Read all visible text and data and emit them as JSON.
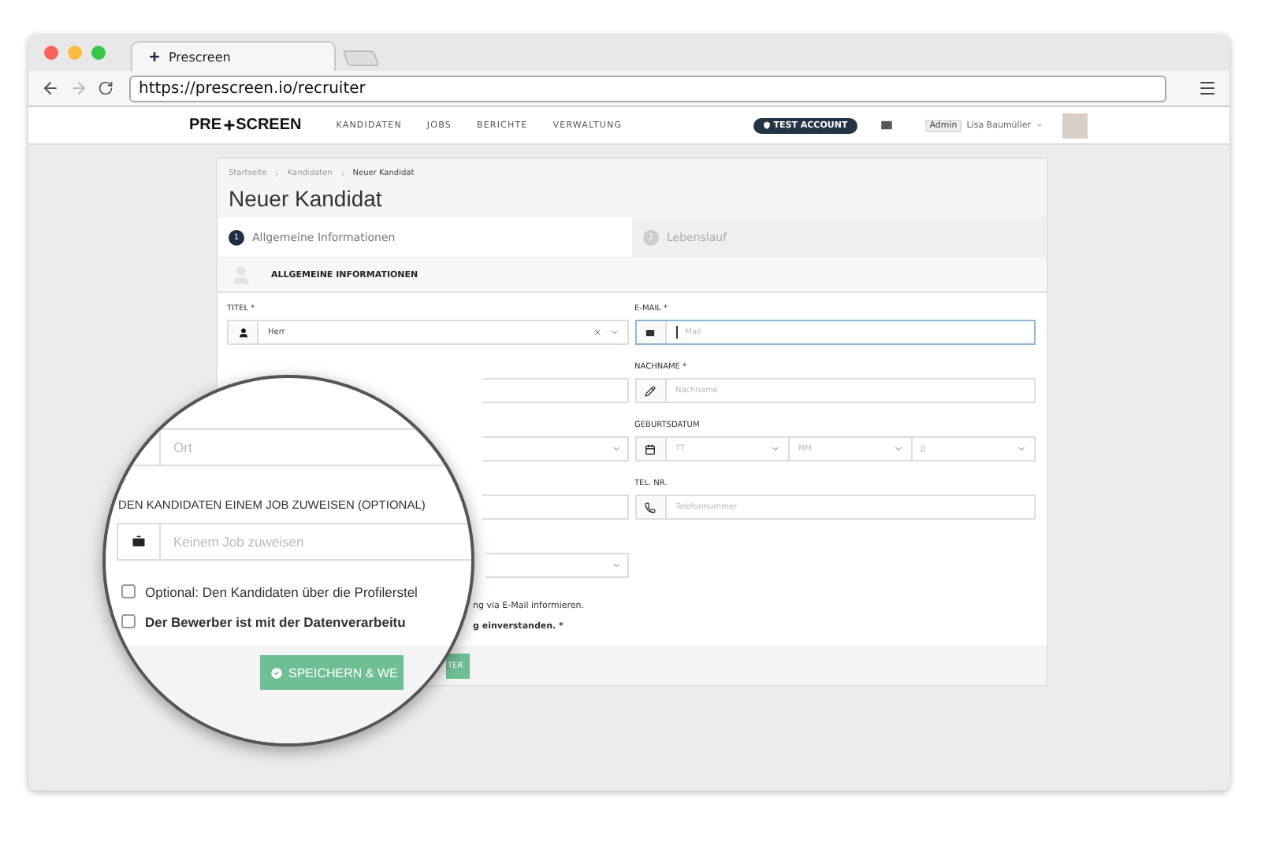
{
  "browser": {
    "tab_title": "Prescreen",
    "url": "https://prescreen.io/recruiter"
  },
  "nav": {
    "logo_left": "PRE",
    "logo_right": "SCREEN",
    "items": [
      "KANDIDATEN",
      "JOBS",
      "BERICHTE",
      "VERWALTUNG"
    ],
    "badge": "TEST ACCOUNT",
    "role": "Admin",
    "user": "Lisa Baumüller"
  },
  "breadcrumb": [
    "Startseite",
    "Kandidaten",
    "Neuer Kandidat"
  ],
  "title": "Neuer Kandidat",
  "steps": [
    {
      "number": "1",
      "label": "Allgemeine Informationen",
      "selected": true
    },
    {
      "number": "2",
      "label": "Lebenslauf",
      "selected": false
    }
  ],
  "section": "ALLGEMEINE INFORMATIONEN",
  "left_fields": [
    {
      "kind": "select",
      "label": "TITEL *",
      "value": "Herr",
      "clearable": true
    },
    {
      "kind": "input"
    },
    {
      "kind": "select"
    },
    {
      "kind": "input"
    },
    {
      "kind": "select"
    }
  ],
  "right_fields": [
    {
      "kind": "input",
      "label": "E-MAIL *",
      "placeholder": "Mail",
      "focused": true
    },
    {
      "kind": "input",
      "label": "NACHNAME *",
      "placeholder": "Nachname",
      "focused": false
    },
    {
      "kind": "date",
      "label": "GEBURTSDATUM",
      "parts": [
        "TT",
        "MM",
        "JJ"
      ]
    },
    {
      "kind": "input",
      "label": "TEL. NR.",
      "placeholder": "Telefonnummer",
      "focused": false
    }
  ],
  "consent_fragments": [
    {
      "text": "ng via E-Mail informieren.",
      "bold": false
    },
    {
      "text": "g einverstanden. *",
      "bold": true
    }
  ],
  "button_fragment": "TER",
  "magnifier": {
    "place_placeholder": "Ort",
    "job_label": "DEN KANDIDATEN EINEM JOB ZUWEISEN (OPTIONAL)",
    "job_placeholder": "Keinem Job zuweisen",
    "checkboxes": [
      {
        "label": "Optional: Den Kandidaten über die Profilerstel",
        "checked": false,
        "bold": false
      },
      {
        "label": "Der Bewerber ist mit der Datenverarbeitu",
        "checked": false,
        "bold": true
      }
    ],
    "button": "SPEICHERN & WE"
  }
}
